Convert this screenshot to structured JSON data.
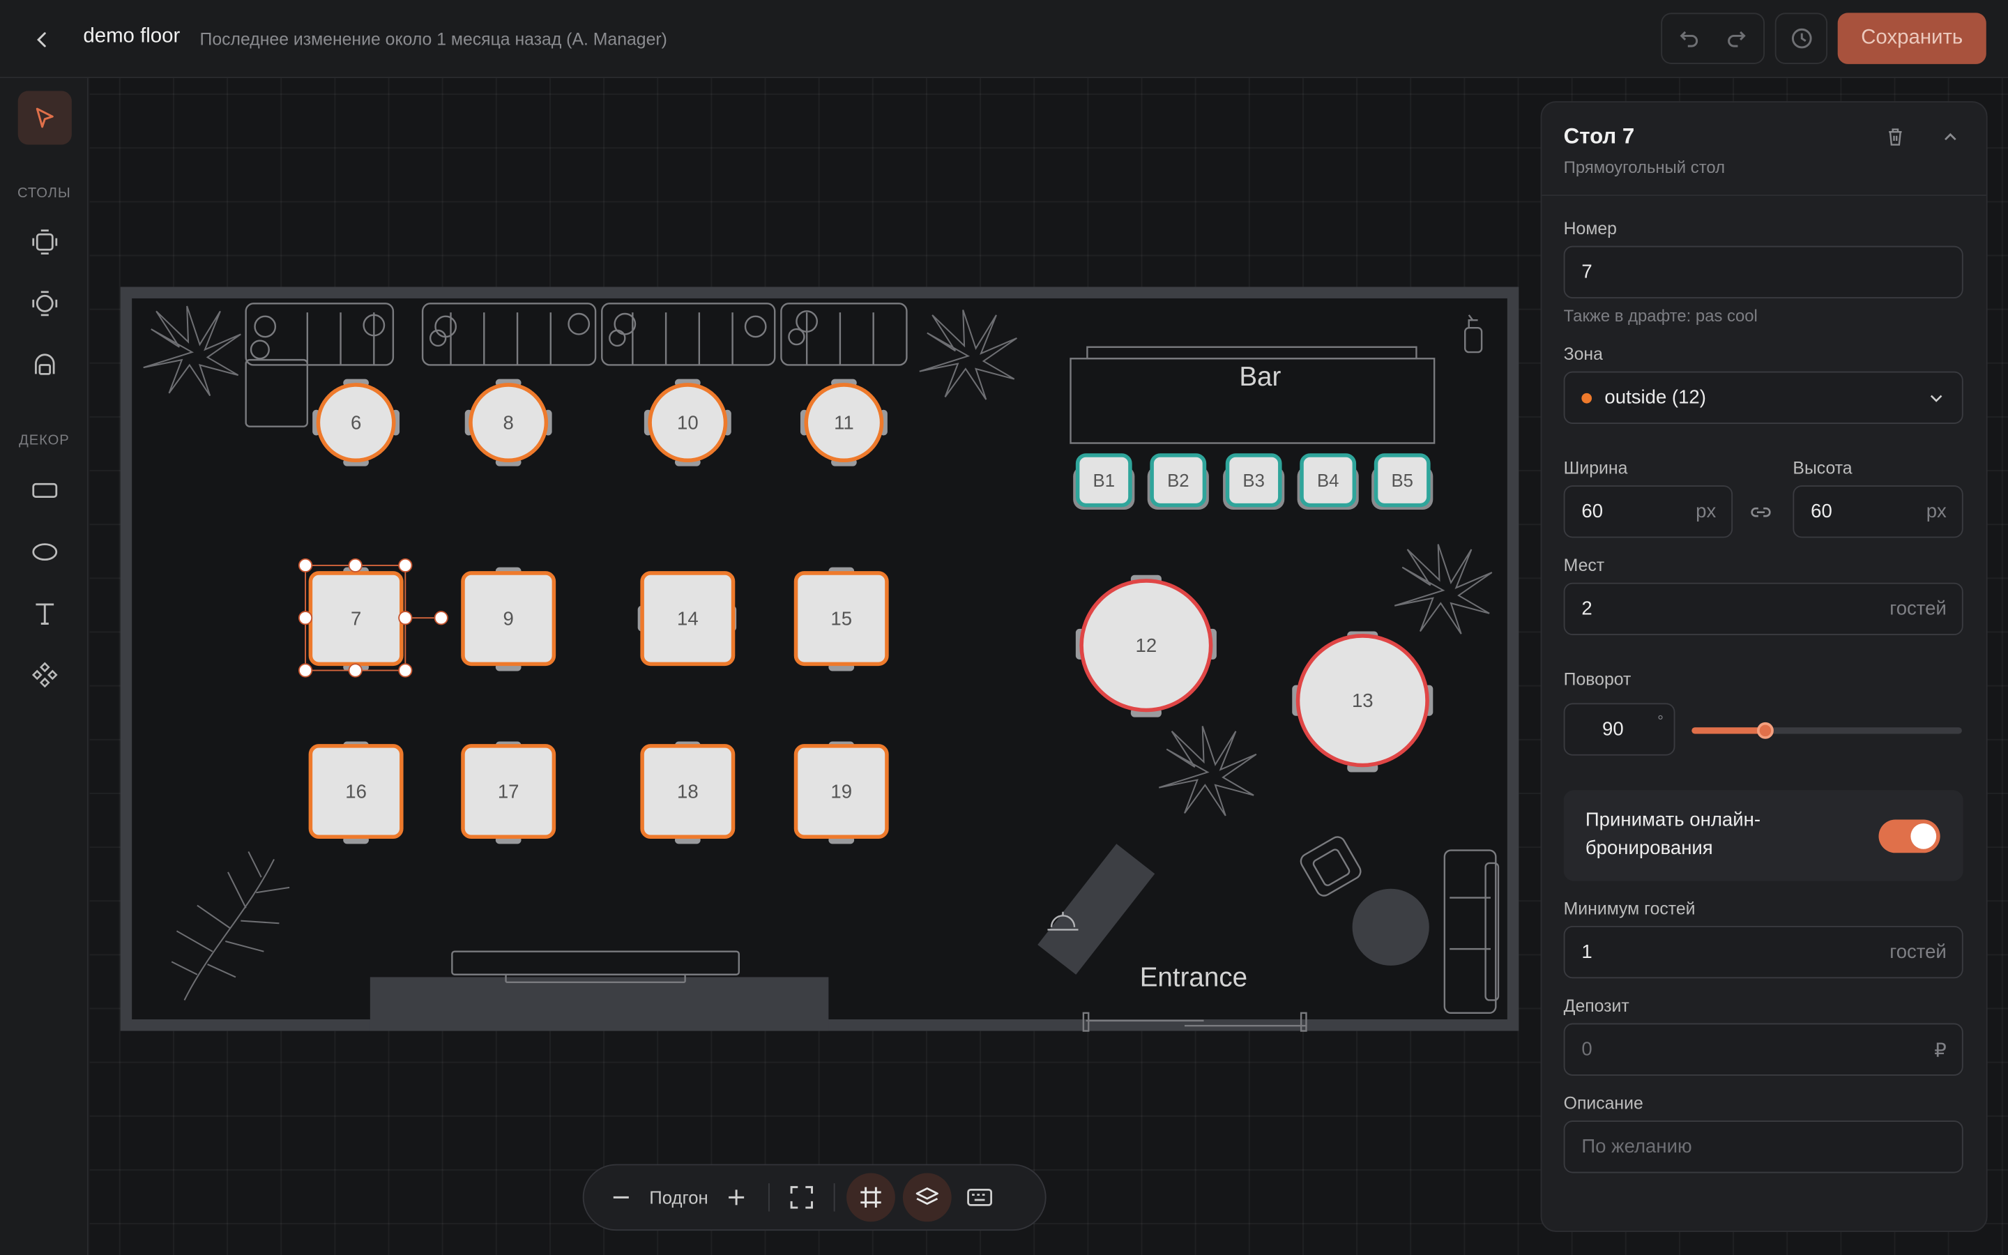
{
  "header": {
    "floor_name": "demo floor",
    "last_change": "Последнее изменение около 1 месяца назад (A. Manager)",
    "save_label": "Сохранить"
  },
  "toolbar": {
    "section_tables": "СТОЛЫ",
    "section_decor": "ДЕКОР"
  },
  "floor": {
    "bar_label": "Bar",
    "entrance_label": "Entrance",
    "round_tables": [
      "6",
      "8",
      "10",
      "11"
    ],
    "square_tables_row1": [
      "7",
      "9",
      "14",
      "15"
    ],
    "square_tables_row2": [
      "16",
      "17",
      "18",
      "19"
    ],
    "bar_seats": [
      "B1",
      "B2",
      "B3",
      "B4",
      "B5"
    ],
    "large_tables": [
      "12",
      "13"
    ],
    "selected_table": "7",
    "colors": {
      "round_square": "#ee7a2c",
      "bar": "#2fa59b",
      "large": "#e04646"
    }
  },
  "zoombar": {
    "fit_label": "Подгон"
  },
  "panel": {
    "title": "Стол 7",
    "subtitle": "Прямоугольный стол",
    "number_label": "Номер",
    "number_value": "7",
    "number_hint": "Также в драфте: pas cool",
    "zone_label": "Зона",
    "zone_value": "outside (12)",
    "width_label": "Ширина",
    "width_value": "60",
    "width_unit": "px",
    "height_label": "Высота",
    "height_value": "60",
    "height_unit": "px",
    "seats_label": "Мест",
    "seats_value": "2",
    "seats_unit": "гостей",
    "rotation_label": "Поворот",
    "rotation_value": "90",
    "rotation_unit": "°",
    "rotation_fraction": 0.27,
    "online_label": "Принимать онлайн-бронирования",
    "online_enabled": true,
    "min_guests_label": "Минимум гостей",
    "min_guests_value": "1",
    "min_guests_unit": "гостей",
    "deposit_label": "Депозит",
    "deposit_value": "0",
    "deposit_unit": "₽",
    "description_label": "Описание",
    "description_placeholder": "По желанию"
  }
}
